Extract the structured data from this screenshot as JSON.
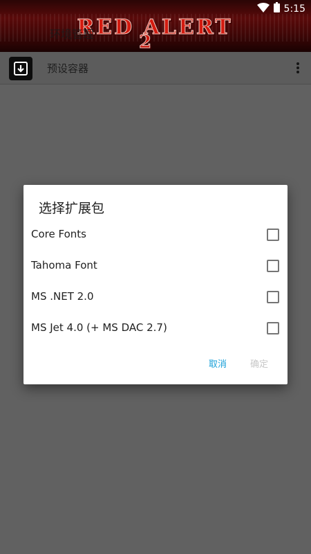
{
  "status_bar": {
    "time": "5:15"
  },
  "banner": {
    "title": "RED ALERT",
    "number": "2",
    "overlay_text": "环境管理"
  },
  "app_bar": {
    "title": "预设容器"
  },
  "dialog": {
    "title": "选择扩展包",
    "options": [
      {
        "label": "Core Fonts",
        "checked": false
      },
      {
        "label": "Tahoma Font",
        "checked": false
      },
      {
        "label": "MS .NET 2.0",
        "checked": false
      },
      {
        "label": "MS Jet 4.0 (+ MS DAC 2.7)",
        "checked": false
      }
    ],
    "cancel_label": "取消",
    "ok_label": "确定"
  },
  "colors": {
    "accent": "#1aa0d8",
    "disabled": "#c8c8c8",
    "scrim": "#616161",
    "banner_red": "#d31b10"
  }
}
